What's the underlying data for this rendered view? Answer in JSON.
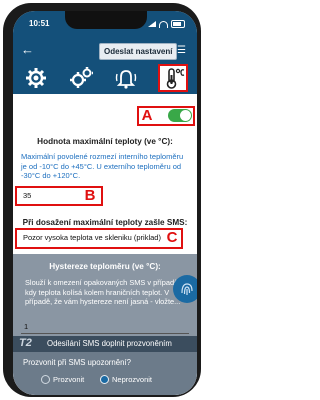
{
  "status": {
    "time": "10:51"
  },
  "toolbar": {
    "send_label": "Odeslat nastavení"
  },
  "icons": [
    "gear-icon",
    "gears-icon",
    "bell-icon",
    "thermometer-icon"
  ],
  "annotations": {
    "a": "A",
    "b": "B",
    "c": "C"
  },
  "max_temp": {
    "title": "Hodnota maximální teploty (ve °C):",
    "info": "Maximální povolené rozmezí interního teploměru je od -10°C do +45°C. U externího teploměru od -30°C do +120°C.",
    "value": "35",
    "enabled": true
  },
  "sms": {
    "title": "Při dosažení maximální teploty zašle SMS:",
    "value": "Pozor vysoka teplota ve skleniku (priklad)"
  },
  "hysteresis": {
    "title": "Hystereze teploměru (ve °C):",
    "info": "Slouží k omezení opakovaných SMS v případě, kdy teplota kolísá kolem hraničních teplot. V případě, že vám hystereze není jasná - vložte...",
    "value": "1"
  },
  "t2": {
    "badge": "T2",
    "text": "Odesílání SMS doplnit prozvoněním"
  },
  "ring": {
    "question": "Prozvonit při SMS upozornění?",
    "options": [
      "Prozvonit",
      "Neprozvonit"
    ],
    "selected": "Neprozvonit"
  },
  "colors": {
    "accent": "#14507a",
    "marker": "#e01010",
    "toggle_on": "#39a848"
  }
}
